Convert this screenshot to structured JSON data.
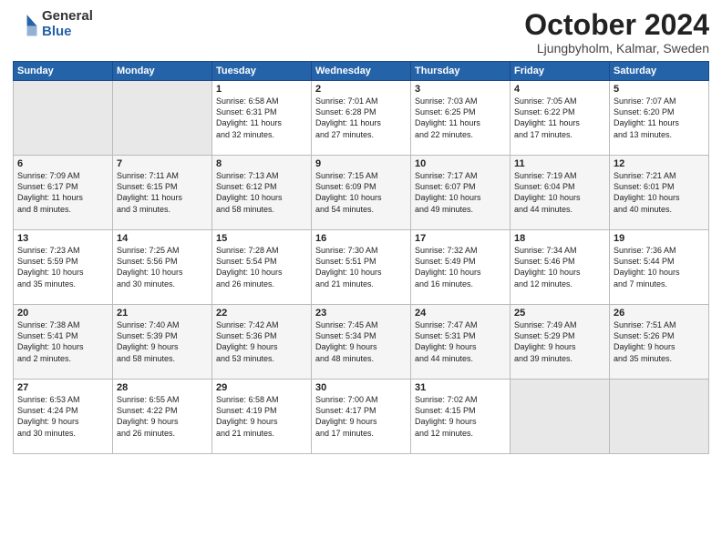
{
  "header": {
    "logo_general": "General",
    "logo_blue": "Blue",
    "title": "October 2024",
    "subtitle": "Ljungbyholm, Kalmar, Sweden"
  },
  "days_of_week": [
    "Sunday",
    "Monday",
    "Tuesday",
    "Wednesday",
    "Thursday",
    "Friday",
    "Saturday"
  ],
  "weeks": [
    [
      {
        "num": "",
        "info": ""
      },
      {
        "num": "",
        "info": ""
      },
      {
        "num": "1",
        "info": "Sunrise: 6:58 AM\nSunset: 6:31 PM\nDaylight: 11 hours\nand 32 minutes."
      },
      {
        "num": "2",
        "info": "Sunrise: 7:01 AM\nSunset: 6:28 PM\nDaylight: 11 hours\nand 27 minutes."
      },
      {
        "num": "3",
        "info": "Sunrise: 7:03 AM\nSunset: 6:25 PM\nDaylight: 11 hours\nand 22 minutes."
      },
      {
        "num": "4",
        "info": "Sunrise: 7:05 AM\nSunset: 6:22 PM\nDaylight: 11 hours\nand 17 minutes."
      },
      {
        "num": "5",
        "info": "Sunrise: 7:07 AM\nSunset: 6:20 PM\nDaylight: 11 hours\nand 13 minutes."
      }
    ],
    [
      {
        "num": "6",
        "info": "Sunrise: 7:09 AM\nSunset: 6:17 PM\nDaylight: 11 hours\nand 8 minutes."
      },
      {
        "num": "7",
        "info": "Sunrise: 7:11 AM\nSunset: 6:15 PM\nDaylight: 11 hours\nand 3 minutes."
      },
      {
        "num": "8",
        "info": "Sunrise: 7:13 AM\nSunset: 6:12 PM\nDaylight: 10 hours\nand 58 minutes."
      },
      {
        "num": "9",
        "info": "Sunrise: 7:15 AM\nSunset: 6:09 PM\nDaylight: 10 hours\nand 54 minutes."
      },
      {
        "num": "10",
        "info": "Sunrise: 7:17 AM\nSunset: 6:07 PM\nDaylight: 10 hours\nand 49 minutes."
      },
      {
        "num": "11",
        "info": "Sunrise: 7:19 AM\nSunset: 6:04 PM\nDaylight: 10 hours\nand 44 minutes."
      },
      {
        "num": "12",
        "info": "Sunrise: 7:21 AM\nSunset: 6:01 PM\nDaylight: 10 hours\nand 40 minutes."
      }
    ],
    [
      {
        "num": "13",
        "info": "Sunrise: 7:23 AM\nSunset: 5:59 PM\nDaylight: 10 hours\nand 35 minutes."
      },
      {
        "num": "14",
        "info": "Sunrise: 7:25 AM\nSunset: 5:56 PM\nDaylight: 10 hours\nand 30 minutes."
      },
      {
        "num": "15",
        "info": "Sunrise: 7:28 AM\nSunset: 5:54 PM\nDaylight: 10 hours\nand 26 minutes."
      },
      {
        "num": "16",
        "info": "Sunrise: 7:30 AM\nSunset: 5:51 PM\nDaylight: 10 hours\nand 21 minutes."
      },
      {
        "num": "17",
        "info": "Sunrise: 7:32 AM\nSunset: 5:49 PM\nDaylight: 10 hours\nand 16 minutes."
      },
      {
        "num": "18",
        "info": "Sunrise: 7:34 AM\nSunset: 5:46 PM\nDaylight: 10 hours\nand 12 minutes."
      },
      {
        "num": "19",
        "info": "Sunrise: 7:36 AM\nSunset: 5:44 PM\nDaylight: 10 hours\nand 7 minutes."
      }
    ],
    [
      {
        "num": "20",
        "info": "Sunrise: 7:38 AM\nSunset: 5:41 PM\nDaylight: 10 hours\nand 2 minutes."
      },
      {
        "num": "21",
        "info": "Sunrise: 7:40 AM\nSunset: 5:39 PM\nDaylight: 9 hours\nand 58 minutes."
      },
      {
        "num": "22",
        "info": "Sunrise: 7:42 AM\nSunset: 5:36 PM\nDaylight: 9 hours\nand 53 minutes."
      },
      {
        "num": "23",
        "info": "Sunrise: 7:45 AM\nSunset: 5:34 PM\nDaylight: 9 hours\nand 48 minutes."
      },
      {
        "num": "24",
        "info": "Sunrise: 7:47 AM\nSunset: 5:31 PM\nDaylight: 9 hours\nand 44 minutes."
      },
      {
        "num": "25",
        "info": "Sunrise: 7:49 AM\nSunset: 5:29 PM\nDaylight: 9 hours\nand 39 minutes."
      },
      {
        "num": "26",
        "info": "Sunrise: 7:51 AM\nSunset: 5:26 PM\nDaylight: 9 hours\nand 35 minutes."
      }
    ],
    [
      {
        "num": "27",
        "info": "Sunrise: 6:53 AM\nSunset: 4:24 PM\nDaylight: 9 hours\nand 30 minutes."
      },
      {
        "num": "28",
        "info": "Sunrise: 6:55 AM\nSunset: 4:22 PM\nDaylight: 9 hours\nand 26 minutes."
      },
      {
        "num": "29",
        "info": "Sunrise: 6:58 AM\nSunset: 4:19 PM\nDaylight: 9 hours\nand 21 minutes."
      },
      {
        "num": "30",
        "info": "Sunrise: 7:00 AM\nSunset: 4:17 PM\nDaylight: 9 hours\nand 17 minutes."
      },
      {
        "num": "31",
        "info": "Sunrise: 7:02 AM\nSunset: 4:15 PM\nDaylight: 9 hours\nand 12 minutes."
      },
      {
        "num": "",
        "info": ""
      },
      {
        "num": "",
        "info": ""
      }
    ]
  ]
}
